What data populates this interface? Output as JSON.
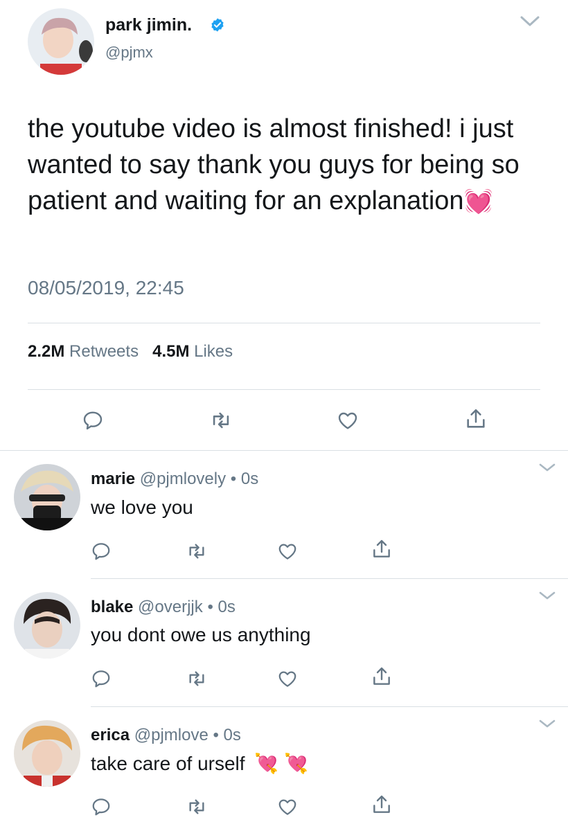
{
  "main_tweet": {
    "display_name": "park jimin.",
    "handle": "@pjmx",
    "verified": true,
    "text": "the youtube video is almost finished! i just wanted to say thank you guys for being so patient and waiting for an explanation",
    "emoji": "💓",
    "timestamp": "08/05/2019, 22:45",
    "retweets_count": "2.2M",
    "retweets_label": "Retweets",
    "likes_count": "4.5M",
    "likes_label": "Likes",
    "actions": [
      "reply-icon",
      "retweet-icon",
      "like-icon",
      "share-icon"
    ]
  },
  "replies": [
    {
      "name": "marie",
      "handle": "@pjmlovely",
      "sep": "•",
      "time": "0s",
      "text": "we love you",
      "emoji": ""
    },
    {
      "name": "blake",
      "handle": "@overjjk",
      "sep": "•",
      "time": "0s",
      "text": "you dont owe us anything",
      "emoji": ""
    },
    {
      "name": "erica",
      "handle": "@pjmlove",
      "sep": "•",
      "time": "0s",
      "text": "take care of urself",
      "emoji": "💘 💘"
    }
  ],
  "colors": {
    "text": "#14171a",
    "secondary": "#657786",
    "verified": "#1da1f2",
    "divider": "#d9dfe3"
  }
}
